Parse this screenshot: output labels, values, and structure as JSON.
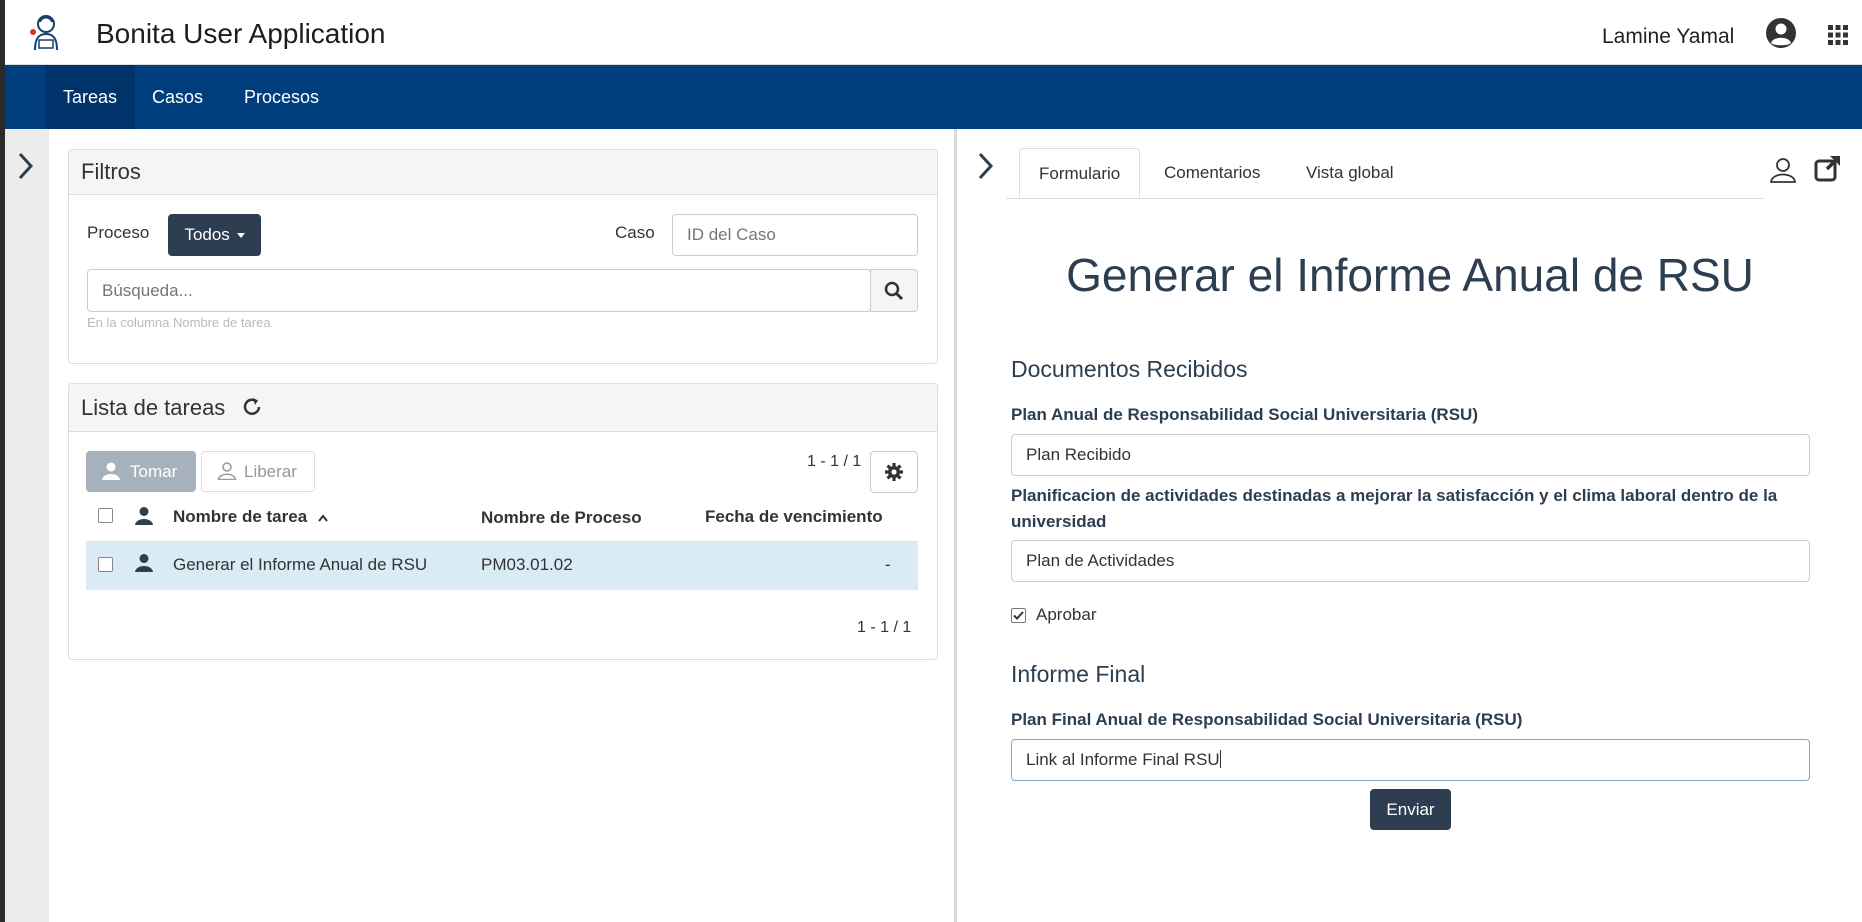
{
  "header": {
    "app_title": "Bonita User Application",
    "user_name": "Lamine Yamal"
  },
  "nav": {
    "items": [
      {
        "label": "Tareas",
        "active": true
      },
      {
        "label": "Casos",
        "active": false
      },
      {
        "label": "Procesos",
        "active": false
      }
    ]
  },
  "filters": {
    "title": "Filtros",
    "process_label": "Proceso",
    "process_dropdown": "Todos",
    "case_label": "Caso",
    "case_placeholder": "ID del Caso",
    "search_placeholder": "Búsqueda...",
    "search_hint": "En la columna Nombre de tarea"
  },
  "task_list": {
    "title": "Lista de tareas",
    "take_button": "Tomar",
    "release_button": "Liberar",
    "pagination_top": "1 - 1 / 1",
    "pagination_bottom": "1 - 1 / 1",
    "columns": [
      "Nombre de tarea",
      "Nombre de Proceso",
      "Fecha de vencimiento"
    ],
    "rows": [
      {
        "task": "Generar el Informe Anual de RSU",
        "process": "PM03.01.02",
        "due": "-"
      }
    ]
  },
  "detail_tabs": [
    "Formulario",
    "Comentarios",
    "Vista global"
  ],
  "form": {
    "title": "Generar el Informe Anual de RSU",
    "section1": "Documentos Recibidos",
    "field1_label": "Plan Anual de Responsabilidad Social Universitaria (RSU)",
    "field1_value": "Plan Recibido",
    "field2_label": "Planificacion de actividades destinadas a mejorar la satisfacción y el clima laboral dentro de la universidad",
    "field2_value": "Plan de Actividades",
    "approve_label": "Aprobar",
    "approve_checked": true,
    "section2": "Informe Final",
    "field3_label": "Plan Final Anual de Responsabilidad Social Universitaria (RSU)",
    "field3_value": "Link al Informe Final RSU",
    "submit_label": "Enviar"
  },
  "colors": {
    "navbar": "#003e7e",
    "nav_active": "#00336a",
    "dark_button": "#2c3e50",
    "selected_row": "#d9ebf5"
  }
}
